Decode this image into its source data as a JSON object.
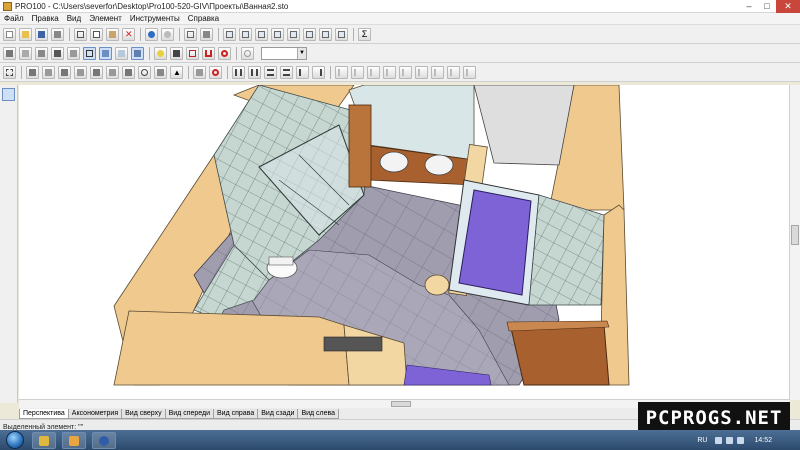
{
  "window": {
    "title": "PRO100 - C:\\Users\\severfor\\Desktop\\Pro100-520-GIV\\Проекты\\Ванная2.sto",
    "minimize_icon": "minimize-icon",
    "maximize_icon": "maximize-icon",
    "close_icon": "close-icon"
  },
  "menu": [
    {
      "label": "Файл"
    },
    {
      "label": "Правка"
    },
    {
      "label": "Вид"
    },
    {
      "label": "Элемент"
    },
    {
      "label": "Инструменты"
    },
    {
      "label": "Справка"
    }
  ],
  "toolbar": {
    "zoom_value": ""
  },
  "view_tabs": [
    {
      "label": "Перспектива",
      "active": true
    },
    {
      "label": "Аксонометрия",
      "active": false
    },
    {
      "label": "Вид сверху",
      "active": false
    },
    {
      "label": "Вид спереди",
      "active": false
    },
    {
      "label": "Вид справа",
      "active": false
    },
    {
      "label": "Вид сзади",
      "active": false
    },
    {
      "label": "Вид слева",
      "active": false
    }
  ],
  "status": {
    "selected_label": "Выделенный элемент: \"\""
  },
  "watermark": {
    "text": "PCPROGS.NET"
  },
  "taskbar": {
    "language": "RU",
    "time": "14:52"
  },
  "colors": {
    "wall": "#f0c98f",
    "wall_shade": "#d9a56a",
    "floor": "#9f9dae",
    "tile": "#c6d6d1",
    "tile_line": "#6a7c78",
    "bathtub": "#7e63d6",
    "wood": "#a8602e",
    "glass": "#d9e6e8",
    "toilet": "#fafafa"
  }
}
